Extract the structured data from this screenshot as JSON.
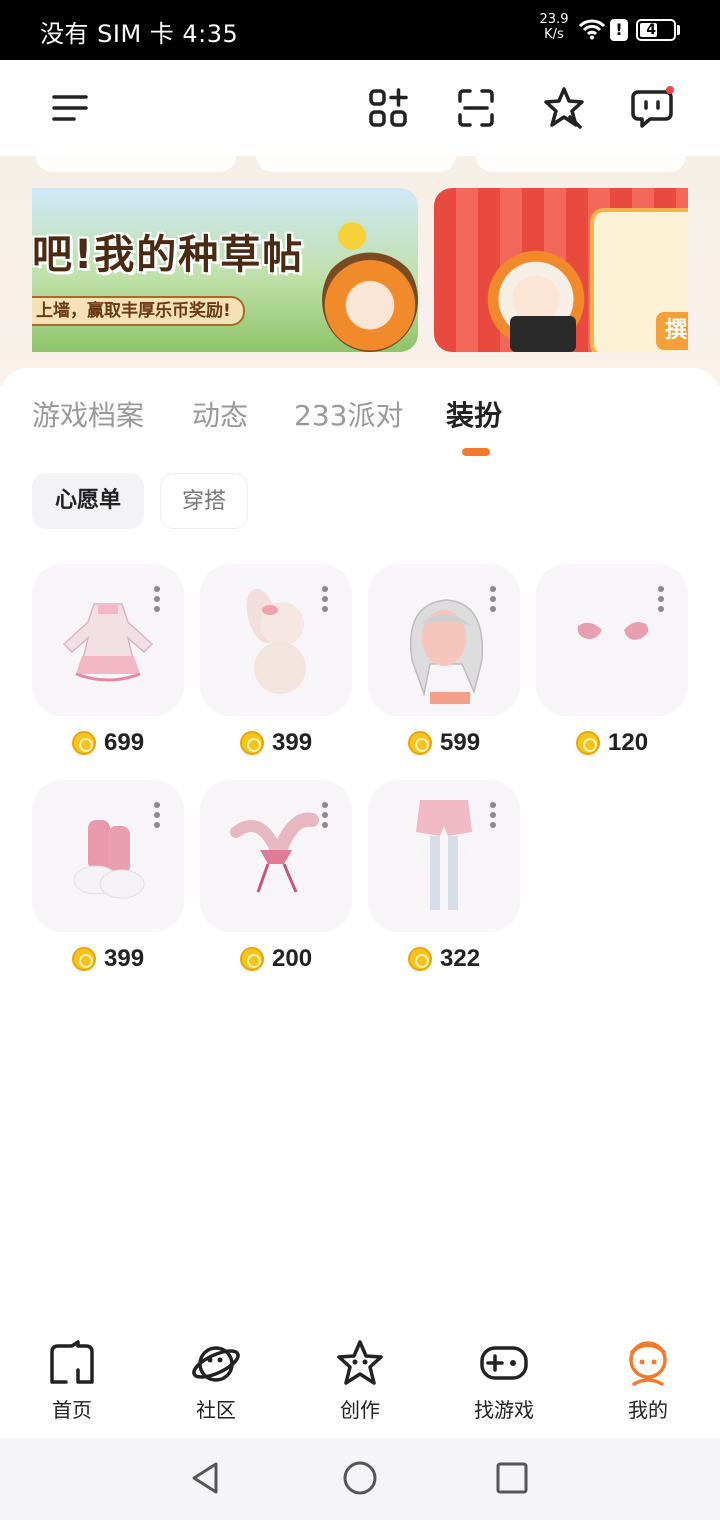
{
  "status_bar": {
    "left_text": "没有 SIM 卡 4:35",
    "speed_value": "23.9",
    "speed_unit": "K/s",
    "battery": "47",
    "alert_glyph": "!"
  },
  "top_bar": {
    "icons": [
      "menu-icon",
      "apps-icon",
      "scan-icon",
      "star-sticker-icon",
      "message-icon"
    ]
  },
  "banners": [
    {
      "title": "吧!我的种草帖",
      "subtitle": "上墙，赢取丰厚乐币奖励!"
    },
    {
      "partial_text": "撰"
    }
  ],
  "tabs": [
    {
      "label": "游戏档案",
      "active": false
    },
    {
      "label": "动态",
      "active": false
    },
    {
      "label": "233派对",
      "active": false
    },
    {
      "label": "装扮",
      "active": true
    }
  ],
  "chips": [
    {
      "label": "心愿单",
      "active": true
    },
    {
      "label": "穿搭",
      "active": false
    }
  ],
  "items": [
    {
      "name": "pink-dress",
      "price": "699"
    },
    {
      "name": "plush-bunny",
      "price": "399"
    },
    {
      "name": "silver-hair",
      "price": "599"
    },
    {
      "name": "pink-wings",
      "price": "120"
    },
    {
      "name": "pink-boots",
      "price": "399"
    },
    {
      "name": "bunny-ear-headband",
      "price": "200"
    },
    {
      "name": "bloomers-stockings",
      "price": "322"
    }
  ],
  "bottom_nav": [
    {
      "label": "首页",
      "icon": "home-icon",
      "active": false
    },
    {
      "label": "社区",
      "icon": "planet-icon",
      "active": false
    },
    {
      "label": "创作",
      "icon": "star-icon",
      "active": false
    },
    {
      "label": "找游戏",
      "icon": "gamepad-icon",
      "active": false
    },
    {
      "label": "我的",
      "icon": "profile-icon",
      "active": true
    }
  ],
  "colors": {
    "accent": "#f27a2a",
    "coin": "#f6c21b",
    "card_bg": "#f7f5f8",
    "notification_dot": "#f04848"
  }
}
